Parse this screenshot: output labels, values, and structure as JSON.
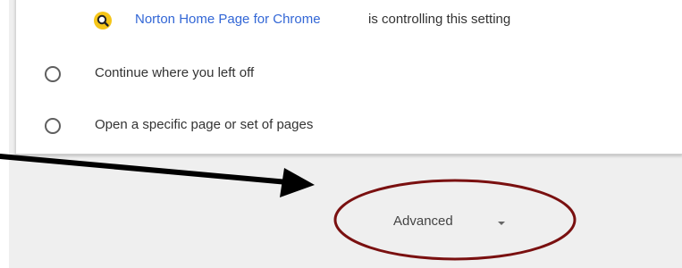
{
  "extension_notice": {
    "icon": "norton-search-icon",
    "link_text": "Norton Home Page for Chrome",
    "suffix_text": "is controlling this setting"
  },
  "startup_options": [
    {
      "label": "Continue where you left off",
      "selected": false
    },
    {
      "label": "Open a specific page or set of pages",
      "selected": false
    }
  ],
  "advanced": {
    "label": "Advanced",
    "icon": "chevron-down-icon"
  },
  "colors": {
    "link": "#3367d6",
    "annotation_circle": "#7a1010",
    "arrow": "#000000",
    "background": "#efefef"
  }
}
